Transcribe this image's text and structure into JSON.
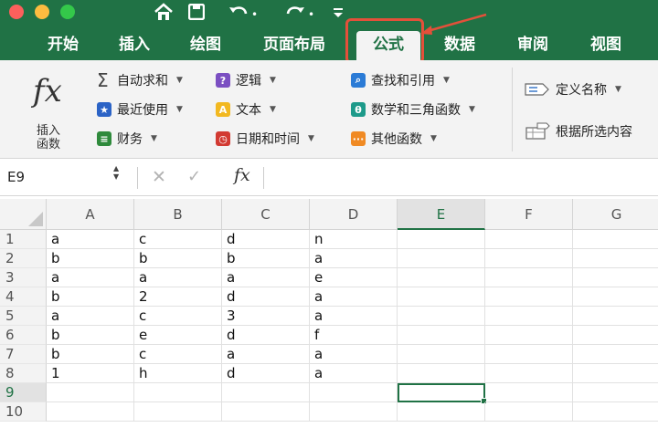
{
  "quick_access": {
    "home_icon": "home-icon",
    "save_icon": "save-icon",
    "undo_icon": "undo-icon",
    "redo_icon": "redo-icon",
    "more_icon": "customize-icon"
  },
  "tabs": [
    {
      "label": "开始"
    },
    {
      "label": "插入"
    },
    {
      "label": "绘图"
    },
    {
      "label": "页面布局"
    },
    {
      "label": "公式",
      "active": true
    },
    {
      "label": "数据"
    },
    {
      "label": "审阅"
    },
    {
      "label": "视图"
    }
  ],
  "ribbon": {
    "insert_function_label": "插入\n函数",
    "groups": [
      {
        "label": "自动求和",
        "icon": "sigma-icon"
      },
      {
        "label": "最近使用",
        "icon": "star-icon"
      },
      {
        "label": "财务",
        "icon": "finance-icon"
      },
      {
        "label": "逻辑",
        "icon": "logic-icon"
      },
      {
        "label": "文本",
        "icon": "text-icon"
      },
      {
        "label": "日期和时间",
        "icon": "clock-icon"
      },
      {
        "label": "查找和引用",
        "icon": "lookup-icon"
      },
      {
        "label": "数学和三角函数",
        "icon": "math-icon"
      },
      {
        "label": "其他函数",
        "icon": "more-functions-icon"
      },
      {
        "label": "定义名称",
        "icon": "define-name-icon"
      },
      {
        "label": "根据所选内容",
        "icon": "create-from-selection-icon"
      }
    ]
  },
  "formula_bar": {
    "name_box": "E9",
    "formula": ""
  },
  "grid": {
    "columns": [
      "A",
      "B",
      "C",
      "D",
      "E",
      "F",
      "G"
    ],
    "rows": [
      "1",
      "2",
      "3",
      "4",
      "5",
      "6",
      "7",
      "8",
      "9",
      "10"
    ],
    "cells": [
      [
        "a",
        "c",
        "d",
        "n"
      ],
      [
        "b",
        "b",
        "b",
        "a"
      ],
      [
        "a",
        "a",
        "a",
        "e"
      ],
      [
        "b",
        "2",
        "d",
        "a"
      ],
      [
        "a",
        "c",
        "3",
        "a"
      ],
      [
        "b",
        "e",
        "d",
        "f"
      ],
      [
        "b",
        "c",
        "a",
        "a"
      ],
      [
        "1",
        "h",
        "d",
        "a"
      ]
    ],
    "active_cell": "E9"
  },
  "colors": {
    "brand": "#207245",
    "callout": "#e3503a"
  }
}
